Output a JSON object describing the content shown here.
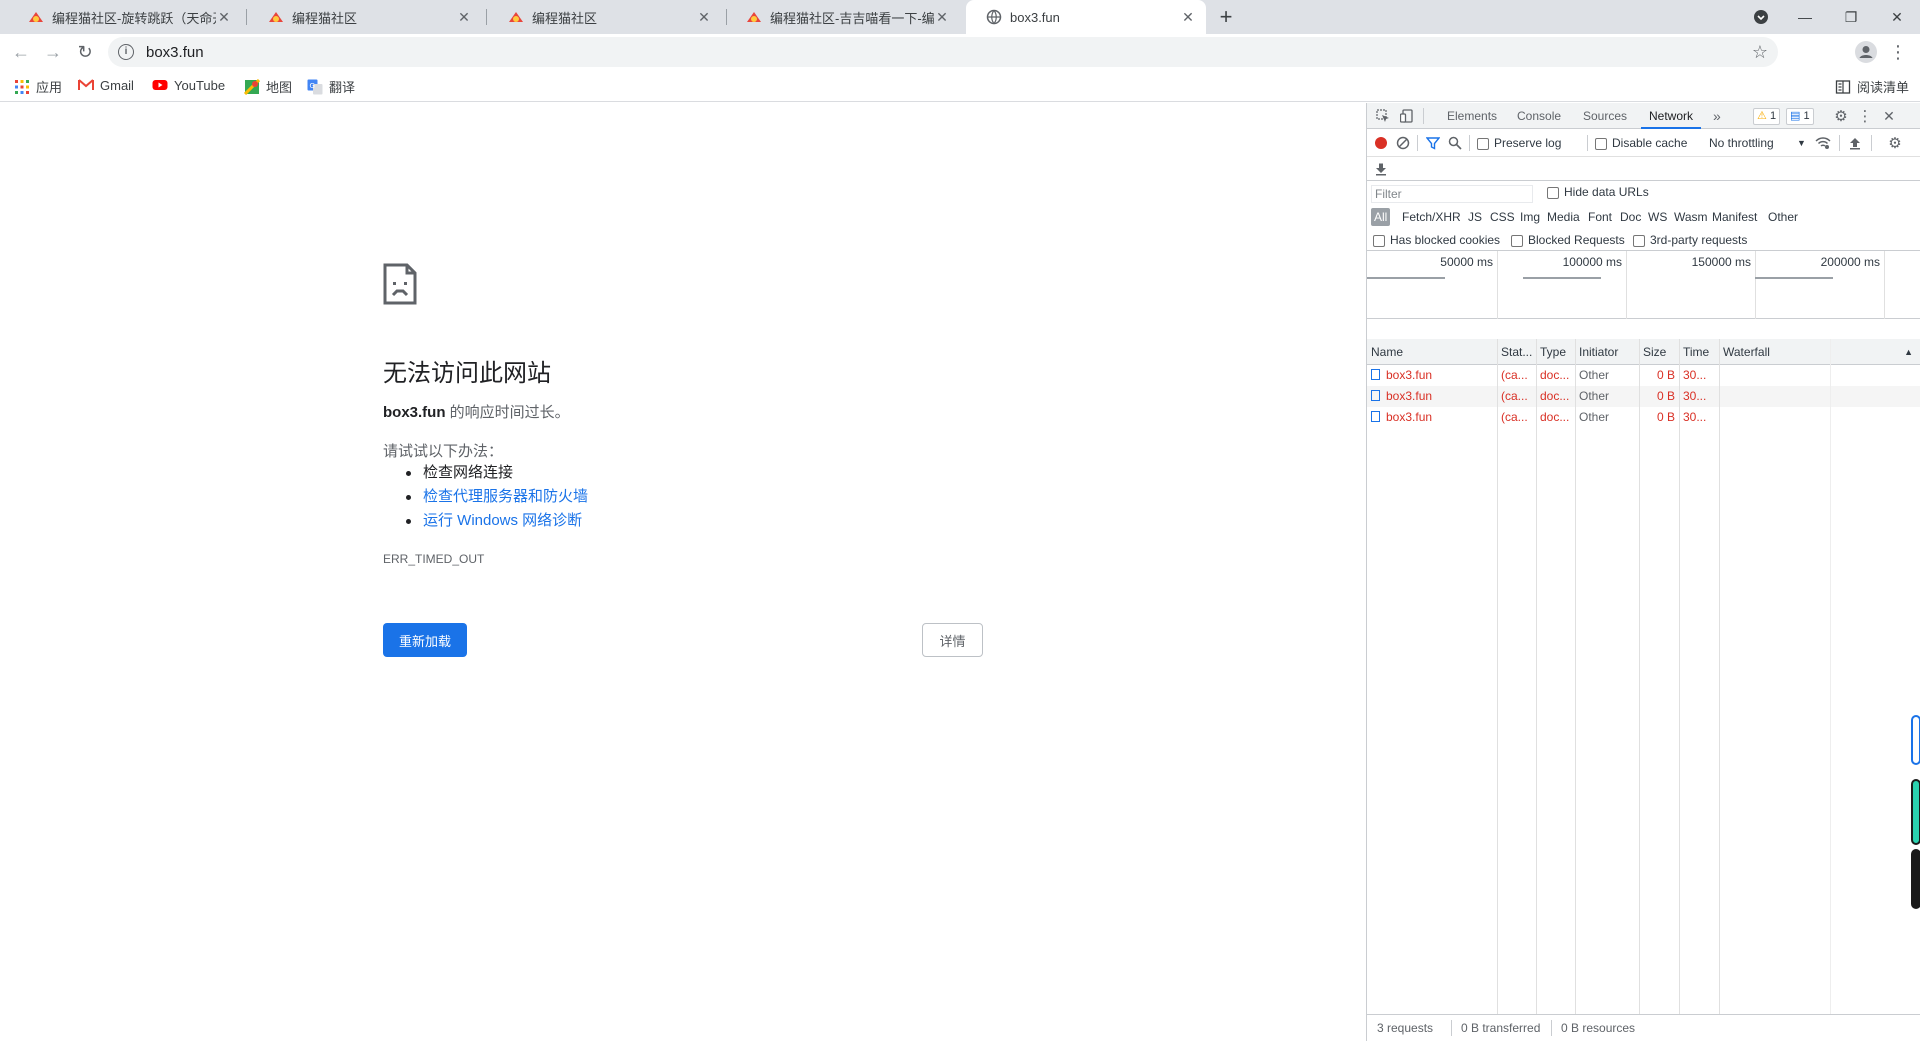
{
  "tabs": [
    {
      "title": "编程猫社区-旋转跳跃（天命开源",
      "active": false,
      "favicon": "codemao-favicon"
    },
    {
      "title": "编程猫社区",
      "active": false,
      "favicon": "codemao-favicon"
    },
    {
      "title": "编程猫社区",
      "active": false,
      "favicon": "codemao-favicon"
    },
    {
      "title": "编程猫社区-吉吉喵看一下-编程",
      "active": false,
      "favicon": "codemao-favicon"
    },
    {
      "title": "box3.fun",
      "active": true,
      "favicon": "globe-icon"
    }
  ],
  "toolbar": {
    "url": "box3.fun"
  },
  "bookmarks": {
    "items": [
      {
        "label": "应用",
        "icon": "apps-grid-icon"
      },
      {
        "label": "Gmail",
        "icon": "gmail-icon"
      },
      {
        "label": "YouTube",
        "icon": "youtube-icon"
      },
      {
        "label": "地图",
        "icon": "maps-icon"
      },
      {
        "label": "翻译",
        "icon": "translate-icon"
      }
    ],
    "reading_list": "阅读清单"
  },
  "error_page": {
    "title": "无法访问此网站",
    "host": "box3.fun",
    "host_suffix": " 的响应时间过长。",
    "suggest_heading": "请试试以下办法：",
    "suggestions": [
      "检查网络连接",
      "检查代理服务器和防火墙",
      "运行 Windows 网络诊断"
    ],
    "error_code": "ERR_TIMED_OUT",
    "reload_label": "重新加载",
    "details_label": "详情"
  },
  "devtools": {
    "tabs": [
      "Elements",
      "Console",
      "Sources",
      "Network"
    ],
    "active_tab": "Network",
    "warn_count": "1",
    "msg_count": "1",
    "toolbar": {
      "preserve_log": "Preserve log",
      "disable_cache": "Disable cache",
      "throttling": "No throttling"
    },
    "filter_placeholder": "Filter",
    "hide_data_urls": "Hide data URLs",
    "types": [
      "All",
      "Fetch/XHR",
      "JS",
      "CSS",
      "Img",
      "Media",
      "Font",
      "Doc",
      "WS",
      "Wasm",
      "Manifest",
      "Other"
    ],
    "options": {
      "blocked_cookies": "Has blocked cookies",
      "blocked_requests": "Blocked Requests",
      "third_party": "3rd-party requests"
    },
    "overview_ticks": [
      "50000 ms",
      "100000 ms",
      "150000 ms",
      "200000 ms"
    ],
    "columns": [
      "Name",
      "Stat...",
      "Type",
      "Initiator",
      "Size",
      "Time",
      "Waterfall"
    ],
    "rows": [
      {
        "name": "box3.fun",
        "status": "(ca...",
        "type": "doc...",
        "initiator": "Other",
        "size": "0 B",
        "time": "30..."
      },
      {
        "name": "box3.fun",
        "status": "(ca...",
        "type": "doc...",
        "initiator": "Other",
        "size": "0 B",
        "time": "30..."
      },
      {
        "name": "box3.fun",
        "status": "(ca...",
        "type": "doc...",
        "initiator": "Other",
        "size": "0 B",
        "time": "30..."
      }
    ],
    "status_bar": {
      "requests": "3 requests",
      "transferred": "0 B transferred",
      "resources": "0 B resources"
    }
  },
  "colors": {
    "accent": "#1a73e8",
    "error": "#d93025",
    "record": "#d93025",
    "tabstrip": "#dee1e6"
  }
}
